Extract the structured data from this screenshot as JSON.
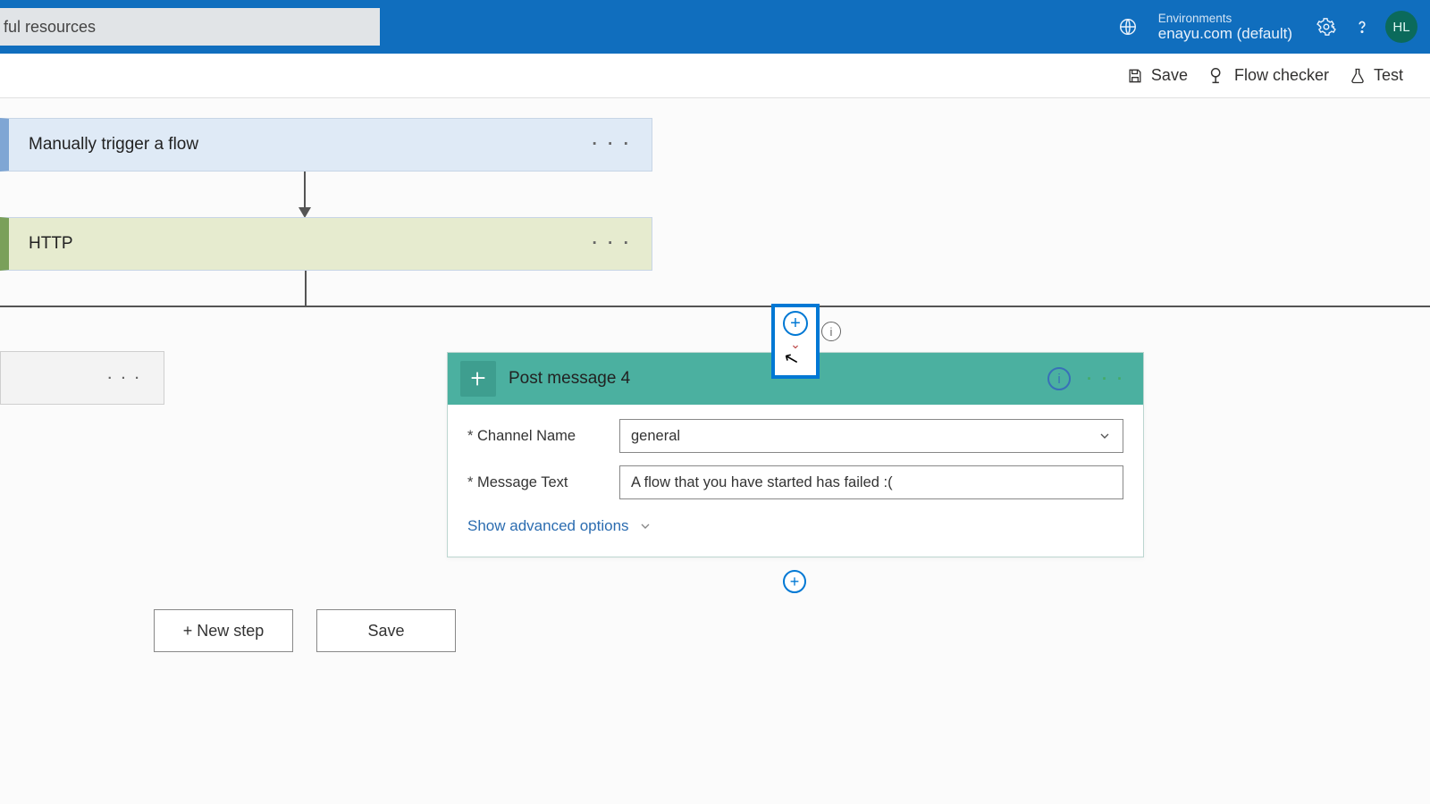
{
  "header": {
    "search_placeholder": "ful resources",
    "env_label": "Environments",
    "env_value": "enayu.com (default)",
    "avatar": "HL"
  },
  "cmdbar": {
    "save": "Save",
    "flow_checker": "Flow checker",
    "test": "Test"
  },
  "flow": {
    "trigger_title": "Manually trigger a flow",
    "http_title": "HTTP",
    "action": {
      "title": "Post message 4",
      "channel_label": "Channel Name",
      "channel_value": "general",
      "text_label": "Message Text",
      "text_value": "A flow that you have started has failed :(",
      "advanced": "Show advanced options"
    }
  },
  "footer": {
    "new_step": "+ New step",
    "save": "Save"
  }
}
